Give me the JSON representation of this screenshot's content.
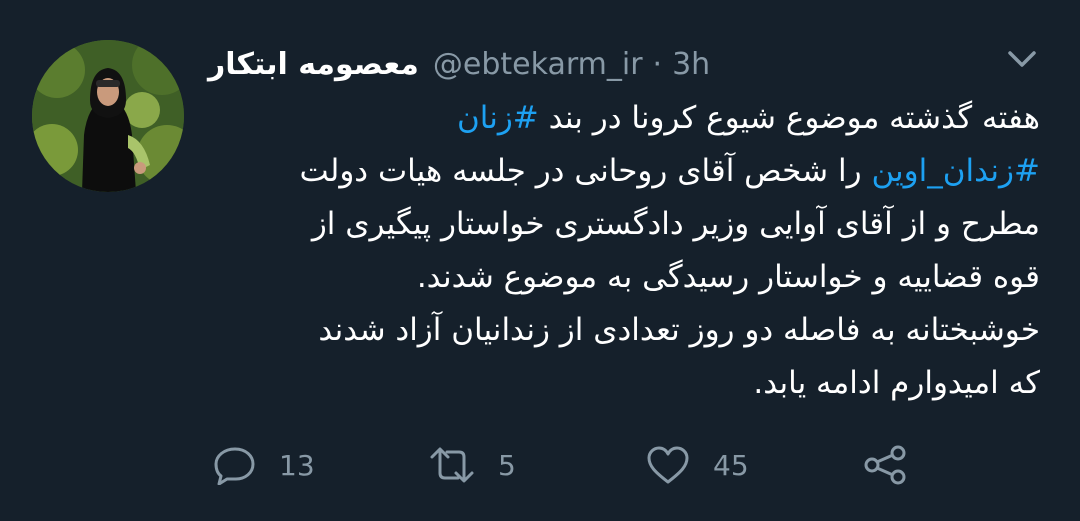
{
  "tweet": {
    "author": {
      "display_name": "معصومه ابتکار",
      "handle": "@ebtekarm_ir",
      "avatar_icon": "profile-photo"
    },
    "separator": "·",
    "time": "3h",
    "menu_icon": "chevron-down-icon",
    "body": {
      "line1": {
        "text": "هفته گذشته موضوع شیوع کرونا در بند ",
        "hashtag": "#زنان"
      },
      "line2": {
        "hashtag": "#زندان_اوین",
        "text": " را شخص آقای روحانی در جلسه هیات دولت"
      },
      "line3": "مطرح و از آقای آوایی وزیر دادگستری خواستار پیگیری از",
      "line4": "قوه قضاییه و خواستار رسیدگی به موضوع شدند.",
      "line5": "خوشبختانه به فاصله دو روز تعدادی از زندانیان آزاد شدند",
      "line6": "که امیدوارم ادامه یابد."
    },
    "actions": {
      "reply": {
        "icon": "reply-icon",
        "count": "13"
      },
      "retweet": {
        "icon": "retweet-icon",
        "count": "5"
      },
      "like": {
        "icon": "like-icon",
        "count": "45"
      },
      "share": {
        "icon": "share-icon"
      }
    }
  },
  "colors": {
    "background": "#15202b",
    "text": "#ffffff",
    "secondary": "#8899a6",
    "accent": "#1da1f2"
  }
}
